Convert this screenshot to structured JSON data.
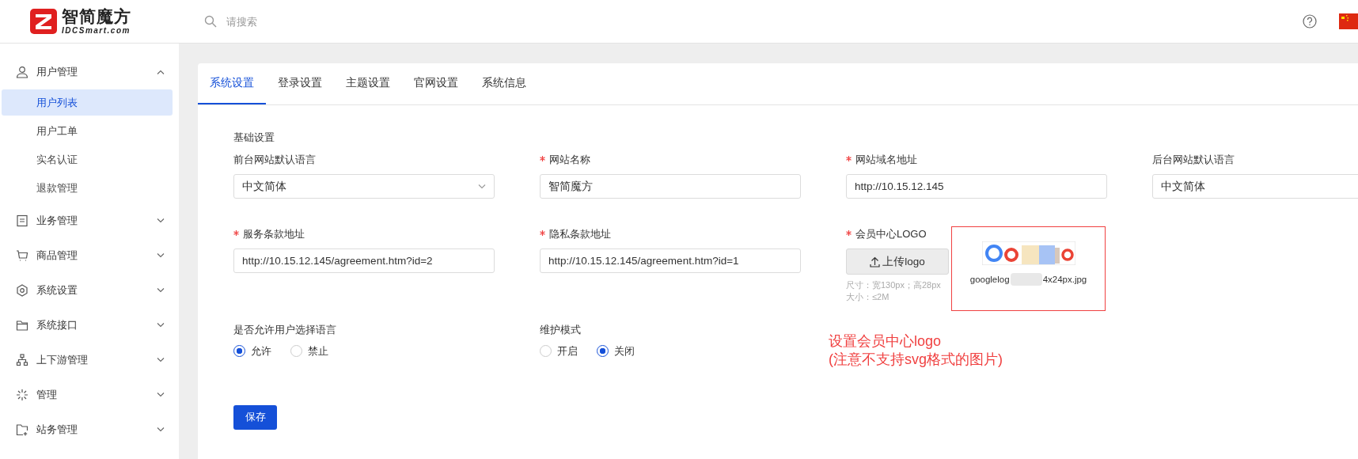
{
  "header": {
    "logo": {
      "name": "智简魔方",
      "domain": "IDCSmart.com"
    },
    "search": {
      "placeholder": "请搜索"
    }
  },
  "sidebar": {
    "items": [
      {
        "label": "用户管理",
        "expanded": true,
        "children": [
          {
            "label": "用户列表",
            "selected": true
          },
          {
            "label": "用户工单",
            "selected": false
          },
          {
            "label": "实名认证",
            "selected": false
          },
          {
            "label": "退款管理",
            "selected": false
          }
        ]
      },
      {
        "label": "业务管理",
        "expanded": false
      },
      {
        "label": "商品管理",
        "expanded": false
      },
      {
        "label": "系统设置",
        "expanded": false
      },
      {
        "label": "系统接口",
        "expanded": false
      },
      {
        "label": "上下游管理",
        "expanded": false
      },
      {
        "label": "管理",
        "expanded": false
      },
      {
        "label": "站务管理",
        "expanded": false
      }
    ]
  },
  "tabs": [
    {
      "label": "系统设置",
      "selected": true
    },
    {
      "label": "登录设置",
      "selected": false
    },
    {
      "label": "主题设置",
      "selected": false
    },
    {
      "label": "官网设置",
      "selected": false
    },
    {
      "label": "系统信息",
      "selected": false
    }
  ],
  "form": {
    "section_title": "基础设置",
    "rows": [
      [
        {
          "kind": "select",
          "label": "前台网站默认语言",
          "required": false,
          "value": "中文简体"
        },
        {
          "kind": "input",
          "label": "网站名称",
          "required": true,
          "value": "智简魔方"
        },
        {
          "kind": "input",
          "label": "网站域名地址",
          "required": true,
          "value": "http://10.15.12.145"
        },
        {
          "kind": "input",
          "label": "后台网站默认语言",
          "required": false,
          "value": "中文简体"
        }
      ],
      [
        {
          "kind": "input",
          "label": "服务条款地址",
          "required": true,
          "value": "http://10.15.12.145/agreement.htm?id=2"
        },
        {
          "kind": "input",
          "label": "隐私条款地址",
          "required": true,
          "value": "http://10.15.12.145/agreement.htm?id=1"
        },
        {
          "kind": "upload",
          "label": "会员中心LOGO",
          "required": true,
          "button": "上传logo",
          "hints": [
            "尺寸：宽130px；高28px",
            "大小：≤2M"
          ],
          "file": {
            "name_start": "googlelog",
            "name_end": "4x24px.jpg"
          }
        }
      ],
      [
        {
          "kind": "radio",
          "label": "是否允许用户选择语言",
          "options": [
            {
              "label": "允许",
              "selected": true
            },
            {
              "label": "禁止",
              "selected": false
            }
          ]
        },
        {
          "kind": "radio",
          "label": "维护模式",
          "options": [
            {
              "label": "开启",
              "selected": false
            },
            {
              "label": "关闭",
              "selected": true
            }
          ]
        },
        {
          "kind": "note",
          "lines": [
            "设置会员中心logo",
            "(注意不支持svg格式的图片)"
          ]
        }
      ]
    ],
    "save_button": "保存"
  }
}
